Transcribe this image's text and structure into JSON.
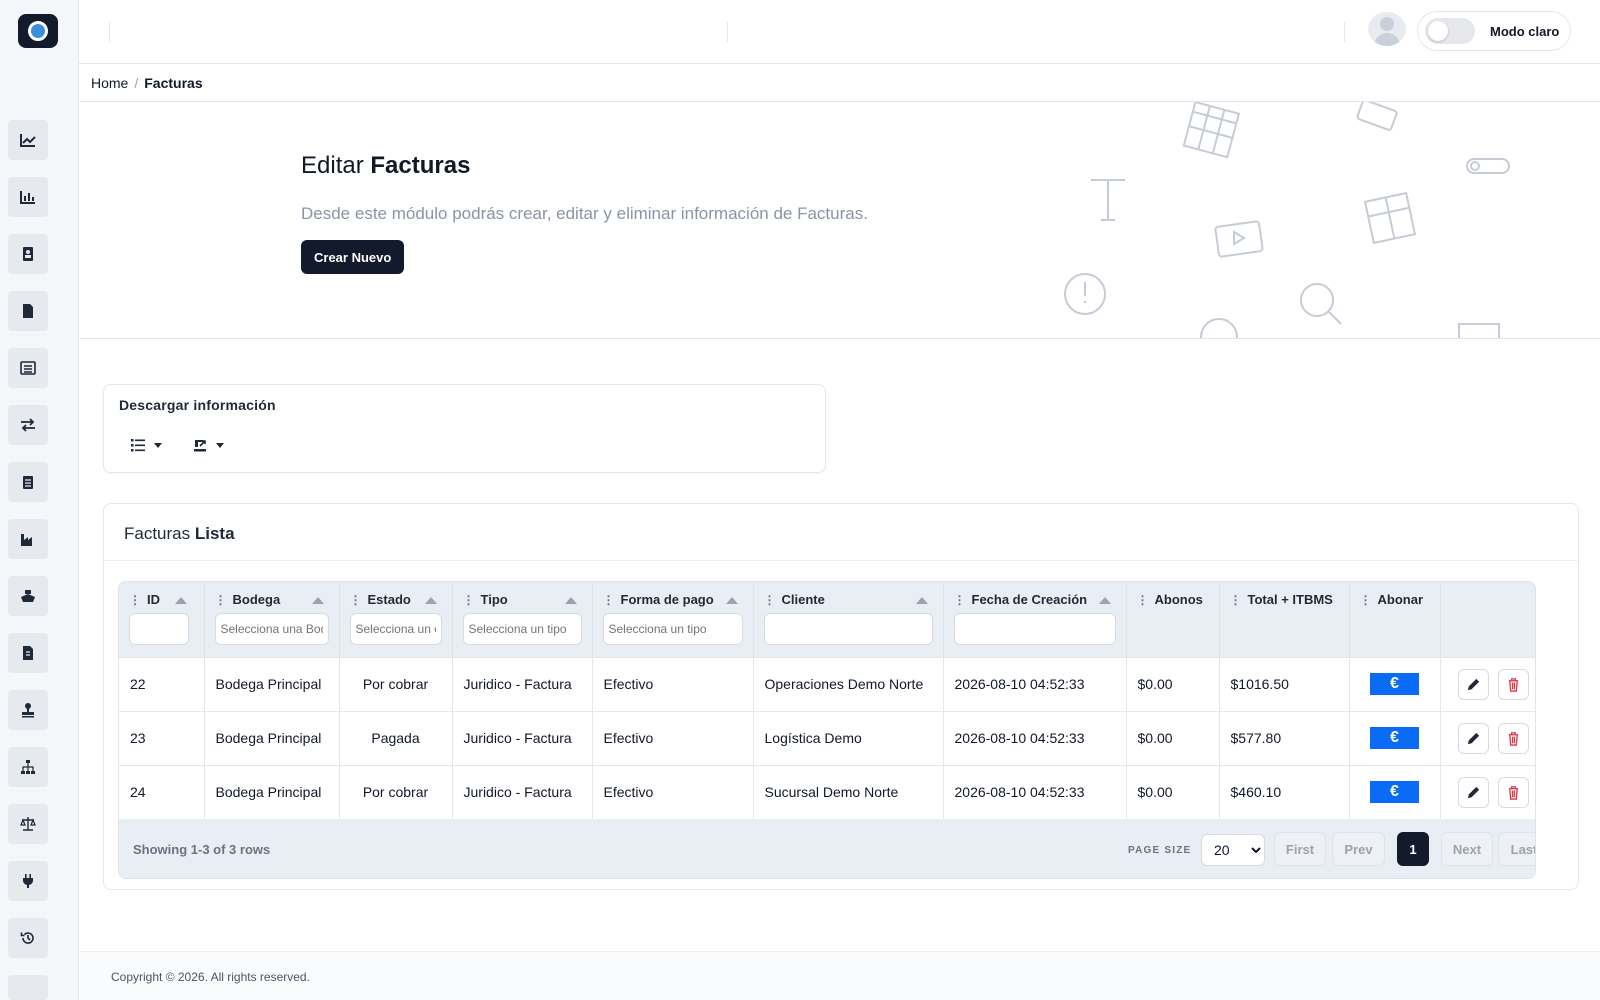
{
  "topbar": {
    "mode_label": "Modo claro",
    "dark_mode_enabled": false
  },
  "breadcrumb": {
    "home": "Home",
    "separator": "/",
    "current": "Facturas"
  },
  "hero": {
    "title_prefix": "Editar",
    "title_strong": "Facturas",
    "subtitle": "Desde este módulo podrás crear, editar y eliminar información de Facturas.",
    "create_button": "Crear Nuevo"
  },
  "download": {
    "title": "Descargar información",
    "icons": [
      "list-icon",
      "export-icon"
    ]
  },
  "list": {
    "title_prefix": "Facturas",
    "title_strong": "Lista",
    "columns": [
      {
        "label": "ID",
        "filter_placeholder": ""
      },
      {
        "label": "Bodega",
        "filter_placeholder": "Selecciona una Bodega"
      },
      {
        "label": "Estado",
        "filter_placeholder": "Selecciona un estado"
      },
      {
        "label": "Tipo",
        "filter_placeholder": "Selecciona un tipo"
      },
      {
        "label": "Forma de pago",
        "filter_placeholder": "Selecciona un tipo"
      },
      {
        "label": "Cliente",
        "filter_placeholder": ""
      },
      {
        "label": "Fecha de Creación",
        "filter_placeholder": ""
      },
      {
        "label": "Abonos"
      },
      {
        "label": "Total + ITBMS"
      },
      {
        "label": "Abonar"
      }
    ],
    "rows": [
      {
        "id": "22",
        "bodega": "Bodega Principal",
        "estado": "Por cobrar",
        "tipo": "Juridico - Factura",
        "forma_pago": "Efectivo",
        "cliente": "Operaciones Demo Norte",
        "fecha": "2026-08-10 04:52:33",
        "abonos": "$0.00",
        "total": "$1016.50",
        "abonar": "€"
      },
      {
        "id": "23",
        "bodega": "Bodega Principal",
        "estado": "Pagada",
        "tipo": "Juridico - Factura",
        "forma_pago": "Efectivo",
        "cliente": "Logística Demo",
        "fecha": "2026-08-10 04:52:33",
        "abonos": "$0.00",
        "total": "$577.80",
        "abonar": "€"
      },
      {
        "id": "24",
        "bodega": "Bodega Principal",
        "estado": "Por cobrar",
        "tipo": "Juridico - Factura",
        "forma_pago": "Efectivo",
        "cliente": "Sucursal Demo Norte",
        "fecha": "2026-08-10 04:52:33",
        "abonos": "$0.00",
        "total": "$460.10",
        "abonar": "€"
      }
    ],
    "footer": {
      "showing": "Showing 1-3 of 3 rows",
      "page_size_label": "PAGE SIZE",
      "page_size_value": "20",
      "first": "First",
      "prev": "Prev",
      "current_page": "1",
      "next": "Next",
      "last": "Last"
    }
  },
  "sidebar": {
    "items": [
      {
        "icon": "line-chart-icon"
      },
      {
        "icon": "bar-chart-icon"
      },
      {
        "icon": "contact-book-icon"
      },
      {
        "icon": "file-icon"
      },
      {
        "icon": "list-alt-icon"
      },
      {
        "icon": "exchange-icon"
      },
      {
        "icon": "clipboard-icon"
      },
      {
        "icon": "industry-icon"
      },
      {
        "icon": "ship-icon"
      },
      {
        "icon": "invoice-icon"
      },
      {
        "icon": "stamp-icon"
      },
      {
        "icon": "sitemap-icon"
      },
      {
        "icon": "balance-scale-icon"
      },
      {
        "icon": "plug-icon"
      },
      {
        "icon": "history-icon"
      }
    ]
  },
  "footer": {
    "copyright": "Copyright © 2026. All rights reserved."
  },
  "colors": {
    "brand_dark": "#121a2b",
    "pay_blue": "#0a6cf5",
    "delete_red": "#dc3545",
    "muted_text": "#8a94a6"
  }
}
